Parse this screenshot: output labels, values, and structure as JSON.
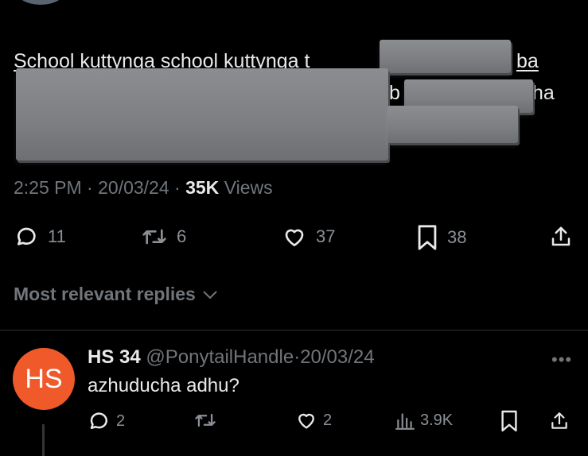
{
  "tweet": {
    "line1_text": "School kuttynga school kuttynga t",
    "line1_tail": "ba",
    "line2_mid": "b",
    "line2_tail": "ha",
    "time": "2:25 PM",
    "date": "20/03/24",
    "views_count": "35K",
    "views_label": "Views",
    "replies": "11",
    "reposts": "6",
    "likes": "37",
    "bookmarks": "38"
  },
  "sort_label": "Most relevant replies",
  "reply": {
    "avatar_initials": "HS",
    "name": "HS 34",
    "handle": "@PonytailHandle",
    "date": "20/03/24",
    "text": "azhuducha adhu?",
    "replies": "2",
    "likes": "2",
    "views": "3.9K"
  },
  "colors": {
    "avatar_bg": "#f0592a",
    "muted": "#71767b",
    "text": "#e7e9ea"
  }
}
